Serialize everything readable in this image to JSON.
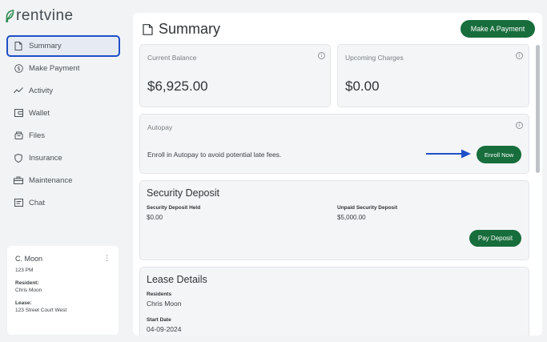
{
  "brand": {
    "logo_text": "rentvine",
    "accent": "#176d3b",
    "highlight": "#1f4fc8"
  },
  "sidebar": {
    "items": [
      {
        "label": "Summary",
        "icon": "document-icon",
        "active": true
      },
      {
        "label": "Make Payment",
        "icon": "dollar-circle-icon"
      },
      {
        "label": "Activity",
        "icon": "activity-wave-icon"
      },
      {
        "label": "Wallet",
        "icon": "wallet-icon"
      },
      {
        "label": "Files",
        "icon": "files-icon"
      },
      {
        "label": "Insurance",
        "icon": "shield-icon"
      },
      {
        "label": "Maintenance",
        "icon": "toolbox-icon"
      },
      {
        "label": "Chat",
        "icon": "chat-icon"
      }
    ]
  },
  "user_card": {
    "name": "C. Moon",
    "unit": "123 PM",
    "resident_label": "Resident:",
    "resident_value": "Chris Moon",
    "lease_label": "Lease:",
    "lease_value": "123 Street Court West"
  },
  "main": {
    "title": "Summary",
    "make_payment_label": "Make A Payment",
    "current_balance": {
      "label": "Current Balance",
      "amount": "$6,925.00"
    },
    "upcoming_charges": {
      "label": "Upcoming Charges",
      "amount": "$0.00"
    },
    "autopay": {
      "label": "Autopay",
      "text": "Enroll in Autopay to avoid potential late fees.",
      "enroll_label": "Enroll Now"
    },
    "security_deposit": {
      "title": "Security Deposit",
      "held_label": "Security Deposit Held",
      "held_value": "$0.00",
      "unpaid_label": "Unpaid Security Deposit",
      "unpaid_value": "$5,000.00",
      "pay_label": "Pay Deposit"
    },
    "lease_details": {
      "title": "Lease Details",
      "residents_label": "Residents",
      "residents_value": "Chris Moon",
      "start_date_label": "Start Date",
      "start_date_value": "04-09-2024"
    }
  }
}
